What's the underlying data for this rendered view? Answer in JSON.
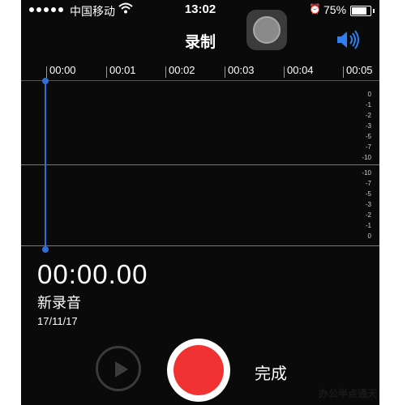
{
  "status_bar": {
    "carrier": "中国移动",
    "time": "13:02",
    "battery": "75%",
    "battery_level": 0.75
  },
  "nav": {
    "title": "录制"
  },
  "timeline": {
    "ticks": [
      "00:00",
      "00:01",
      "00:02",
      "00:03",
      "00:04",
      "00:05"
    ],
    "db_upper": [
      "0",
      "-1",
      "-2",
      "-3",
      "-5",
      "-7",
      "-10"
    ],
    "db_lower": [
      "-10",
      "-7",
      "-5",
      "-3",
      "-2",
      "-1",
      "0"
    ]
  },
  "recording": {
    "elapsed": "00:00.00",
    "name": "新录音",
    "date": "17/11/17"
  },
  "controls": {
    "done_label": "完成"
  },
  "watermark": "办公半点通天",
  "colors": {
    "accent": "#2f6fd6",
    "record": "#f03232",
    "background": "#0a0a0a"
  },
  "icons": [
    "signal-dots-icon",
    "wifi-icon",
    "alarm-icon",
    "battery-icon",
    "assistive-touch-icon",
    "speaker-icon",
    "play-icon",
    "record-icon"
  ]
}
